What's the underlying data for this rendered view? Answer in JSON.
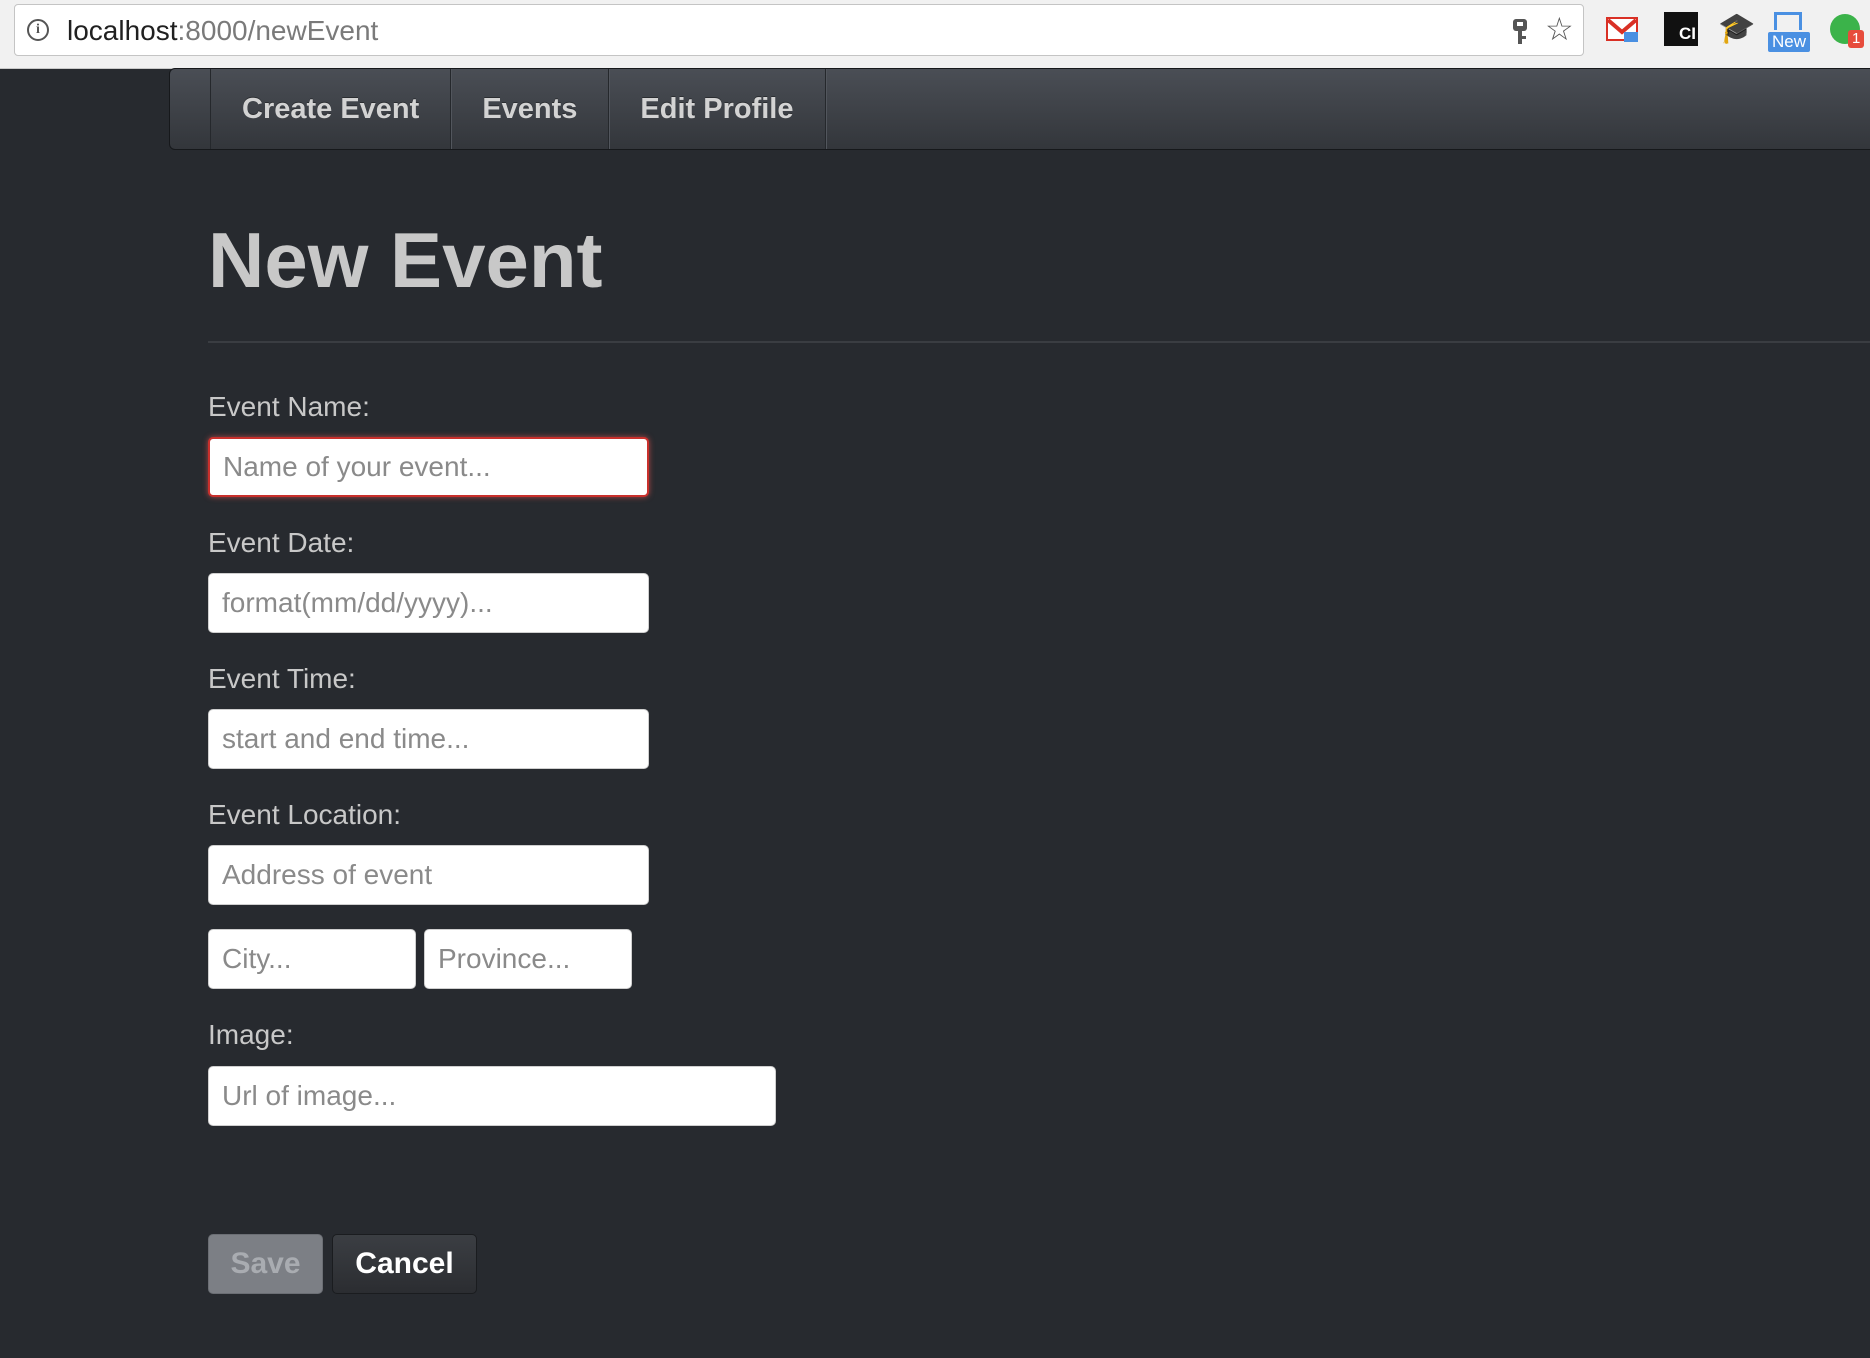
{
  "browser": {
    "url_host": "localhost",
    "url_rest": ":8000/newEvent",
    "extensions": {
      "ci_label": "CI",
      "new_label": "New",
      "badge_count": "1"
    }
  },
  "nav": {
    "items": [
      {
        "label": "Create Event"
      },
      {
        "label": "Events"
      },
      {
        "label": "Edit Profile"
      }
    ]
  },
  "page": {
    "title": "New Event"
  },
  "form": {
    "name_label": "Event Name:",
    "name_placeholder": "Name of your event...",
    "date_label": "Event Date:",
    "date_placeholder": "format(mm/dd/yyyy)...",
    "time_label": "Event Time:",
    "time_placeholder": "start and end time...",
    "location_label": "Event Location:",
    "address_placeholder": "Address of event",
    "city_placeholder": "City...",
    "province_placeholder": "Province...",
    "image_label": "Image:",
    "image_placeholder": "Url of image..."
  },
  "buttons": {
    "save": "Save",
    "cancel": "Cancel"
  },
  "colors": {
    "background": "#272a2f",
    "focus_border": "#c9302c"
  }
}
